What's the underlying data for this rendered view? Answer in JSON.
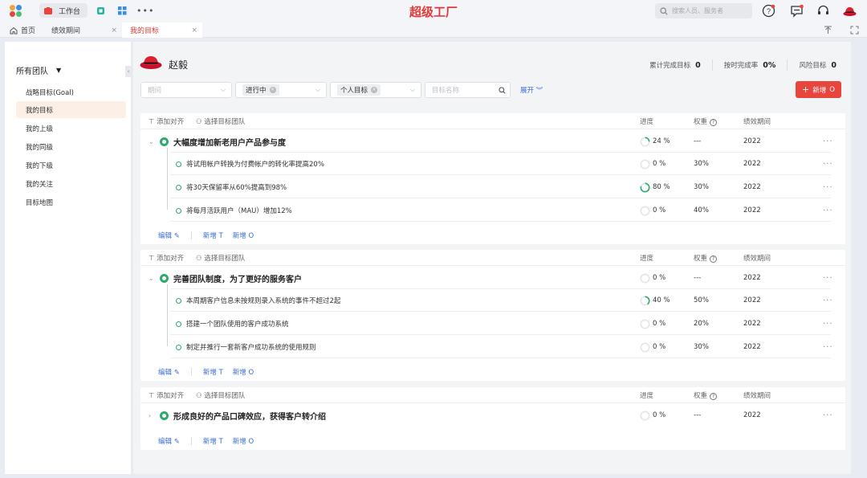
{
  "app": {
    "title": "超级工厂",
    "workspace_label": "工作台",
    "search_placeholder": "搜索人员、服务者"
  },
  "tabs": [
    {
      "label": "首页",
      "closable": false,
      "active": false
    },
    {
      "label": "绩效期间",
      "closable": true,
      "active": false
    },
    {
      "label": "我的目标",
      "closable": true,
      "active": true
    }
  ],
  "sidebar": {
    "team_label": "所有团队",
    "items": [
      {
        "label": "战略目标(Goal)",
        "active": false
      },
      {
        "label": "我的目标",
        "active": true
      },
      {
        "label": "我的上级",
        "active": false
      },
      {
        "label": "我的同级",
        "active": false
      },
      {
        "label": "我的下级",
        "active": false
      },
      {
        "label": "我的关注",
        "active": false
      },
      {
        "label": "目标地图",
        "active": false
      }
    ]
  },
  "user": {
    "name": "赵毅"
  },
  "stats": [
    {
      "label": "累计完成目标",
      "value": "0"
    },
    {
      "label": "按时完成率",
      "value": "0%"
    },
    {
      "label": "风险目标",
      "value": "0"
    }
  ],
  "filters": {
    "period_placeholder": "期间",
    "status_value": "进行中",
    "type_value": "个人目标",
    "name_placeholder": "目标名称",
    "expand_label": "展开"
  },
  "new_button_label": "新增",
  "columns": {
    "add_align": "添加对齐",
    "select_team": "选择目标团队",
    "progress": "进度",
    "weight": "权重",
    "period": "绩效期间"
  },
  "footer_actions": {
    "edit": "编辑",
    "add_t": "新增",
    "add_o": "新增"
  },
  "accent_colors": {
    "brand_red": "#e23a3a",
    "progress_green": "#2faa6f",
    "link_blue": "#3b6cd9"
  },
  "objectives": [
    {
      "title": "大幅度增加新老用户产品参与度",
      "progress": "24 %",
      "progress_value": 24,
      "weight": "---",
      "period": "2022",
      "expanded": true,
      "key_results": [
        {
          "title": "将试用帐户转换为付费帐户的转化率提高20%",
          "progress": "0 %",
          "progress_value": 0,
          "weight": "30%",
          "period": "2022"
        },
        {
          "title": "将30天保留率从60%提高到98%",
          "progress": "80 %",
          "progress_value": 80,
          "weight": "30%",
          "period": "2022"
        },
        {
          "title": "将每月活跃用户（MAU）增加12%",
          "progress": "0 %",
          "progress_value": 0,
          "weight": "40%",
          "period": "2022"
        }
      ]
    },
    {
      "title": "完善团队制度，为了更好的服务客户",
      "progress": "0 %",
      "progress_value": 0,
      "weight": "---",
      "period": "2022",
      "expanded": true,
      "key_results": [
        {
          "title": "本周期客户信息未按规则录入系统的事件不超过2起",
          "progress": "40 %",
          "progress_value": 40,
          "weight": "50%",
          "period": "2022"
        },
        {
          "title": "搭建一个团队使用的客户成功系统",
          "progress": "0 %",
          "progress_value": 0,
          "weight": "20%",
          "period": "2022"
        },
        {
          "title": "制定并推行一套新客户成功系统的使用规则",
          "progress": "0 %",
          "progress_value": 0,
          "weight": "30%",
          "period": "2022"
        }
      ]
    },
    {
      "title": "形成良好的产品口碑效应，获得客户转介绍",
      "progress": "0 %",
      "progress_value": 0,
      "weight": "---",
      "period": "2022",
      "expanded": false,
      "key_results": []
    }
  ]
}
